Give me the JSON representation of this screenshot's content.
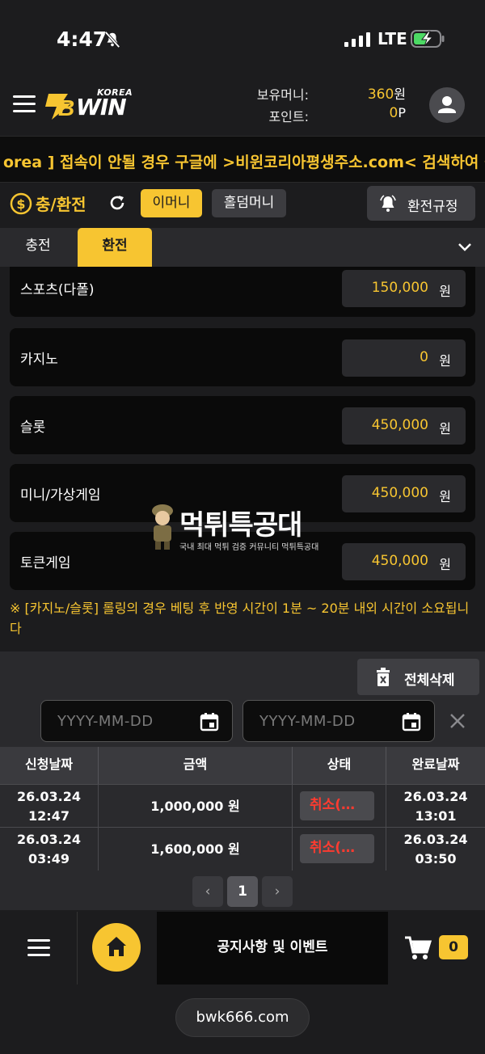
{
  "status_bar": {
    "time": "4:47",
    "network": "LTE"
  },
  "header": {
    "logo_korea": "KOREA",
    "logo_win": "WIN",
    "balance_label": "보유머니:",
    "balance_value": "360",
    "balance_unit": "원",
    "point_label": "포인트:",
    "point_value": "0",
    "point_unit": "P"
  },
  "marquee": {
    "text": "orea ] 접속이 안될 경우 구글에 >비윈코리아평생주소.com< 검색하여 접"
  },
  "titlebar": {
    "title": "충/환전",
    "emoney_label": "이머니",
    "holdem_label": "홀덤머니",
    "rules_label": "환전규정"
  },
  "tabs": [
    {
      "label": "충전"
    },
    {
      "label": "환전"
    }
  ],
  "games": [
    {
      "name": "스포츠(다폴)",
      "amount": "150,000",
      "unit": "원"
    },
    {
      "name": "카지노",
      "amount": "0",
      "unit": "원"
    },
    {
      "name": "슬롯",
      "amount": "450,000",
      "unit": "원"
    },
    {
      "name": "미니/가상게임",
      "amount": "450,000",
      "unit": "원"
    },
    {
      "name": "토큰게임",
      "amount": "450,000",
      "unit": "원"
    }
  ],
  "notice": "※ [카지노/슬롯] 롤링의 경우 베팅 후 반영 시간이 1분 ~ 20분 내외 시간이 소요됩니다",
  "watermark": {
    "title": "먹튀특공대",
    "subtitle": "국내 최대 먹튀 검증 커뮤니티 먹튀특공대"
  },
  "history": {
    "delete_all_label": "전체삭제",
    "date_from_placeholder": "YYYY-MM-DD",
    "date_to_placeholder": "YYYY-MM-DD",
    "columns": [
      "신청날짜",
      "금액",
      "상태",
      "완료날짜"
    ],
    "rows": [
      {
        "req_date": "26.03.24",
        "req_time": "12:47",
        "amount": "1,000,000 원",
        "status": "취소(…",
        "done_date": "26.03.24",
        "done_time": "13:01"
      },
      {
        "req_date": "26.03.24",
        "req_time": "03:49",
        "amount": "1,600,000 원",
        "status": "취소(…",
        "done_date": "26.03.24",
        "done_time": "03:50"
      }
    ],
    "pagination": {
      "prev": "‹",
      "current": "1",
      "next": "›"
    }
  },
  "bottom_nav": {
    "notice_label": "공지사항 및 이벤트",
    "cart_count": "0"
  },
  "browser": {
    "url": "bwk666.com"
  },
  "colors": {
    "accent": "#f7c531",
    "background": "#1c1c1e",
    "danger": "#ff3b30"
  }
}
